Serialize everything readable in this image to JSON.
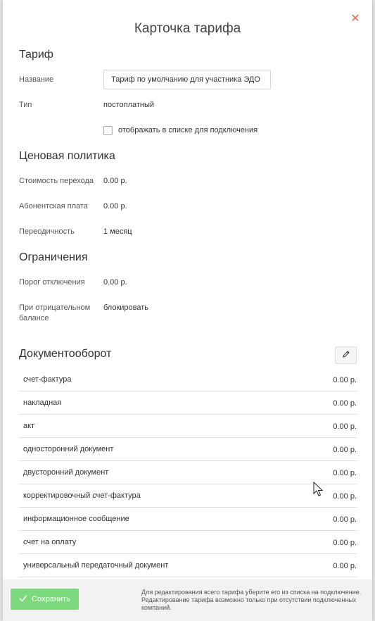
{
  "modal": {
    "title": "Карточка тарифа"
  },
  "tariff": {
    "heading": "Тариф",
    "name_label": "Название",
    "name_value": "Тариф по умолчанию для участника ЭДО",
    "type_label": "Тип",
    "type_value": "постоплатный",
    "show_checkbox_label": "отображать в списке для подключения"
  },
  "pricing": {
    "heading": "Ценовая политика",
    "transition_label": "Стоимость перехода",
    "transition_value": "0.00 р.",
    "fee_label": "Абонентская плата",
    "fee_value": "0.00 р.",
    "period_label": "Переодичность",
    "period_value": "1 месяц"
  },
  "limits": {
    "heading": "Ограничения",
    "threshold_label": "Порог отключения",
    "threshold_value": "0.00 р.",
    "negative_label": "При отрицательном балансе",
    "negative_value": "блокировать"
  },
  "docs": {
    "heading": "Документооборот",
    "rows": [
      {
        "name": "счет-фактура",
        "price": "0.00 р."
      },
      {
        "name": "накладная",
        "price": "0.00 р."
      },
      {
        "name": "акт",
        "price": "0.00 р."
      },
      {
        "name": "односторонний документ",
        "price": "0.00 р."
      },
      {
        "name": "двусторонний документ",
        "price": "0.00 р."
      },
      {
        "name": "корректировочный счет-фактура",
        "price": "0.00 р."
      },
      {
        "name": "информационное сообщение",
        "price": "0.00 р."
      },
      {
        "name": "счет на оплату",
        "price": "0.00 р."
      },
      {
        "name": "универсальный передаточный документ",
        "price": "0.00 р."
      }
    ]
  },
  "footer": {
    "save_label": "Сохранить",
    "note": "Для редактирования всего тарифа уберите его из списка на подключение. Редактирование тарифа возможно только при отсутствии подключенных компаний."
  },
  "colors": {
    "save_button": "#7dd97d",
    "close_icon": "#e06a5a"
  },
  "icons": {
    "close": "close-icon",
    "edit": "pencil-icon",
    "check": "check-icon",
    "cursor": "mouse-cursor-icon"
  }
}
